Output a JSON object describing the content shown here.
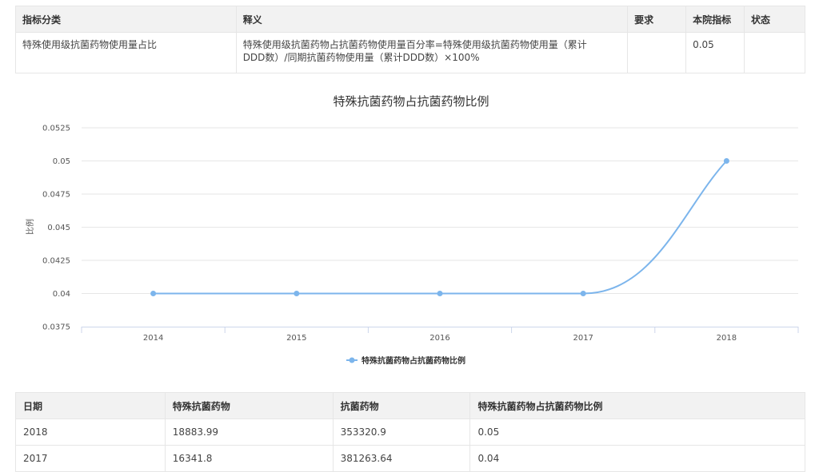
{
  "indicator_table": {
    "headers": [
      "指标分类",
      "释义",
      "要求",
      "本院指标",
      "状态"
    ],
    "row": {
      "category": "特殊使用级抗菌药物使用量占比",
      "definition_line1": "特殊使用级抗菌药物占抗菌药物使用量百分率=特殊使用级抗菌药物使用量（累计",
      "definition_line2": "DDD数）/同期抗菌药物使用量（累计DDD数）×100%",
      "requirement": "",
      "value": "0.05",
      "status": ""
    }
  },
  "chart_data": {
    "type": "line",
    "title": "特殊抗菌药物占抗菌药物比例",
    "ylabel": "比例",
    "categories": [
      "2014",
      "2015",
      "2016",
      "2017",
      "2018"
    ],
    "series": [
      {
        "name": "特殊抗菌药物占抗菌药物比例",
        "values": [
          0.04,
          0.04,
          0.04,
          0.04,
          0.05
        ]
      }
    ],
    "ylim": [
      0.0375,
      0.0525
    ],
    "yticks": [
      "0.0375",
      "0.04",
      "0.0425",
      "0.045",
      "0.0475",
      "0.05",
      "0.0525"
    ],
    "grid": true,
    "legend": "bottom-center",
    "color": "#7cb5ec"
  },
  "data_table": {
    "headers": [
      "日期",
      "特殊抗菌药物",
      "抗菌药物",
      "特殊抗菌药物占抗菌药物比例"
    ],
    "rows": [
      [
        "2018",
        "18883.99",
        "353320.9",
        "0.05"
      ],
      [
        "2017",
        "16341.8",
        "381263.64",
        "0.04"
      ]
    ]
  }
}
